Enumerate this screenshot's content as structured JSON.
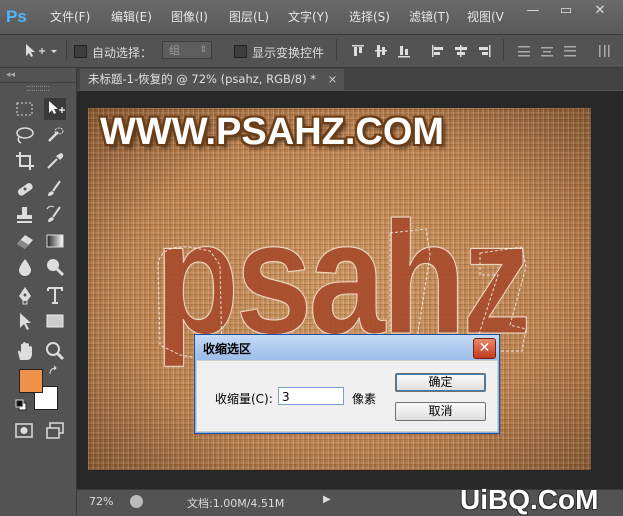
{
  "app": {
    "logo": "Ps"
  },
  "menu": [
    "文件(F)",
    "编辑(E)",
    "图像(I)",
    "图层(L)",
    "文字(Y)",
    "选择(S)",
    "滤镜(T)",
    "视图(V"
  ],
  "window_buttons": {
    "minimize": "—",
    "restore": "▭",
    "close": "✕"
  },
  "options": {
    "auto_select_label": "自动选择：",
    "auto_select_value": "组",
    "transform_label": "显示变换控件"
  },
  "document": {
    "tab_title": "未标题-1-恢复的 @ 72% (psahz, RGB/8) *",
    "tab_close": "×"
  },
  "canvas": {
    "heading": "WWW.PSAHZ.COM",
    "main_text": "psahz"
  },
  "status": {
    "zoom": "72%",
    "doc_info": "文档:1.00M/4.51M",
    "arrow": "▶"
  },
  "dialog": {
    "title": "收缩选区",
    "close": "✕",
    "contract_label": "收缩量(C):",
    "contract_value": "3",
    "unit": "像素",
    "ok": "确定",
    "cancel": "取消"
  },
  "colors": {
    "foreground": "#f0914a",
    "background": "#ffffff",
    "accent": "#4fb6ff"
  },
  "watermark": "UiBQ.CoM"
}
